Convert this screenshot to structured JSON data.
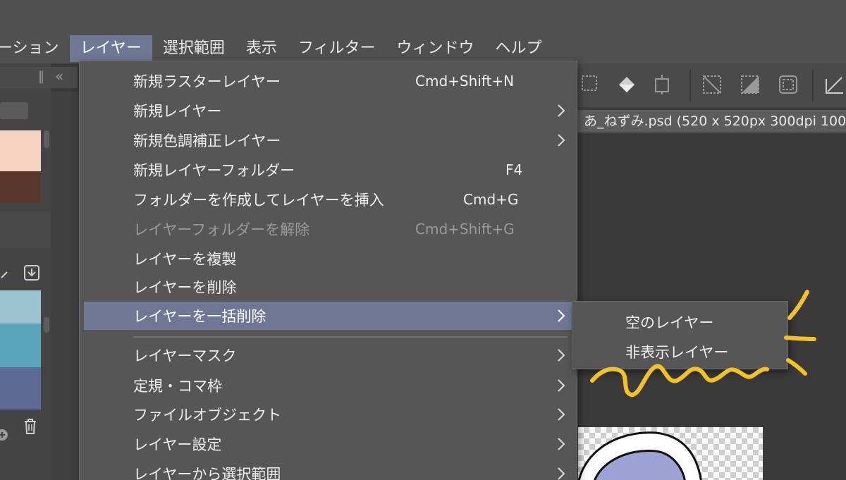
{
  "menubar": {
    "items": [
      "ーション",
      "レイヤー",
      "選択範囲",
      "表示",
      "フィルター",
      "ウィンドウ",
      "ヘルプ"
    ],
    "active_index": 1
  },
  "canvas": {
    "document_tab": "あ_ねずみ.psd (520 x 520px 300dpi 100."
  },
  "layer_menu": {
    "items": [
      {
        "label": "新規ラスターレイヤー",
        "shortcut": "Cmd+Shift+N"
      },
      {
        "label": "新規レイヤー",
        "submenu": true
      },
      {
        "label": "新規色調補正レイヤー",
        "submenu": true
      },
      {
        "label": "新規レイヤーフォルダー",
        "shortcut": "F4"
      },
      {
        "label": "フォルダーを作成してレイヤーを挿入",
        "shortcut": "Cmd+G"
      },
      {
        "label": "レイヤーフォルダーを解除",
        "shortcut": "Cmd+Shift+G",
        "disabled": true
      },
      {
        "label": "レイヤーを複製"
      },
      {
        "label": "レイヤーを削除"
      },
      {
        "label": "レイヤーを一括削除",
        "submenu": true,
        "highlighted": true
      },
      {
        "label": "レイヤーマスク",
        "submenu": true
      },
      {
        "label": "定規・コマ枠",
        "submenu": true
      },
      {
        "label": "ファイルオブジェクト",
        "submenu": true
      },
      {
        "label": "レイヤー設定",
        "submenu": true
      },
      {
        "label": "レイヤーから選択範囲",
        "submenu": true
      }
    ]
  },
  "submenu": {
    "items": [
      "空のレイヤー",
      "非表示レイヤー"
    ]
  },
  "colors": {
    "menu_bg": "#565656",
    "highlight": "#6e7895",
    "annotation": "#f5c223",
    "swatch_peach": "#f6d2c2",
    "swatch_brown": "#58372a",
    "swatch_lightblue": "#9cc4d0",
    "swatch_teal": "#5aa4bc",
    "swatch_slate": "#5e6a92"
  }
}
